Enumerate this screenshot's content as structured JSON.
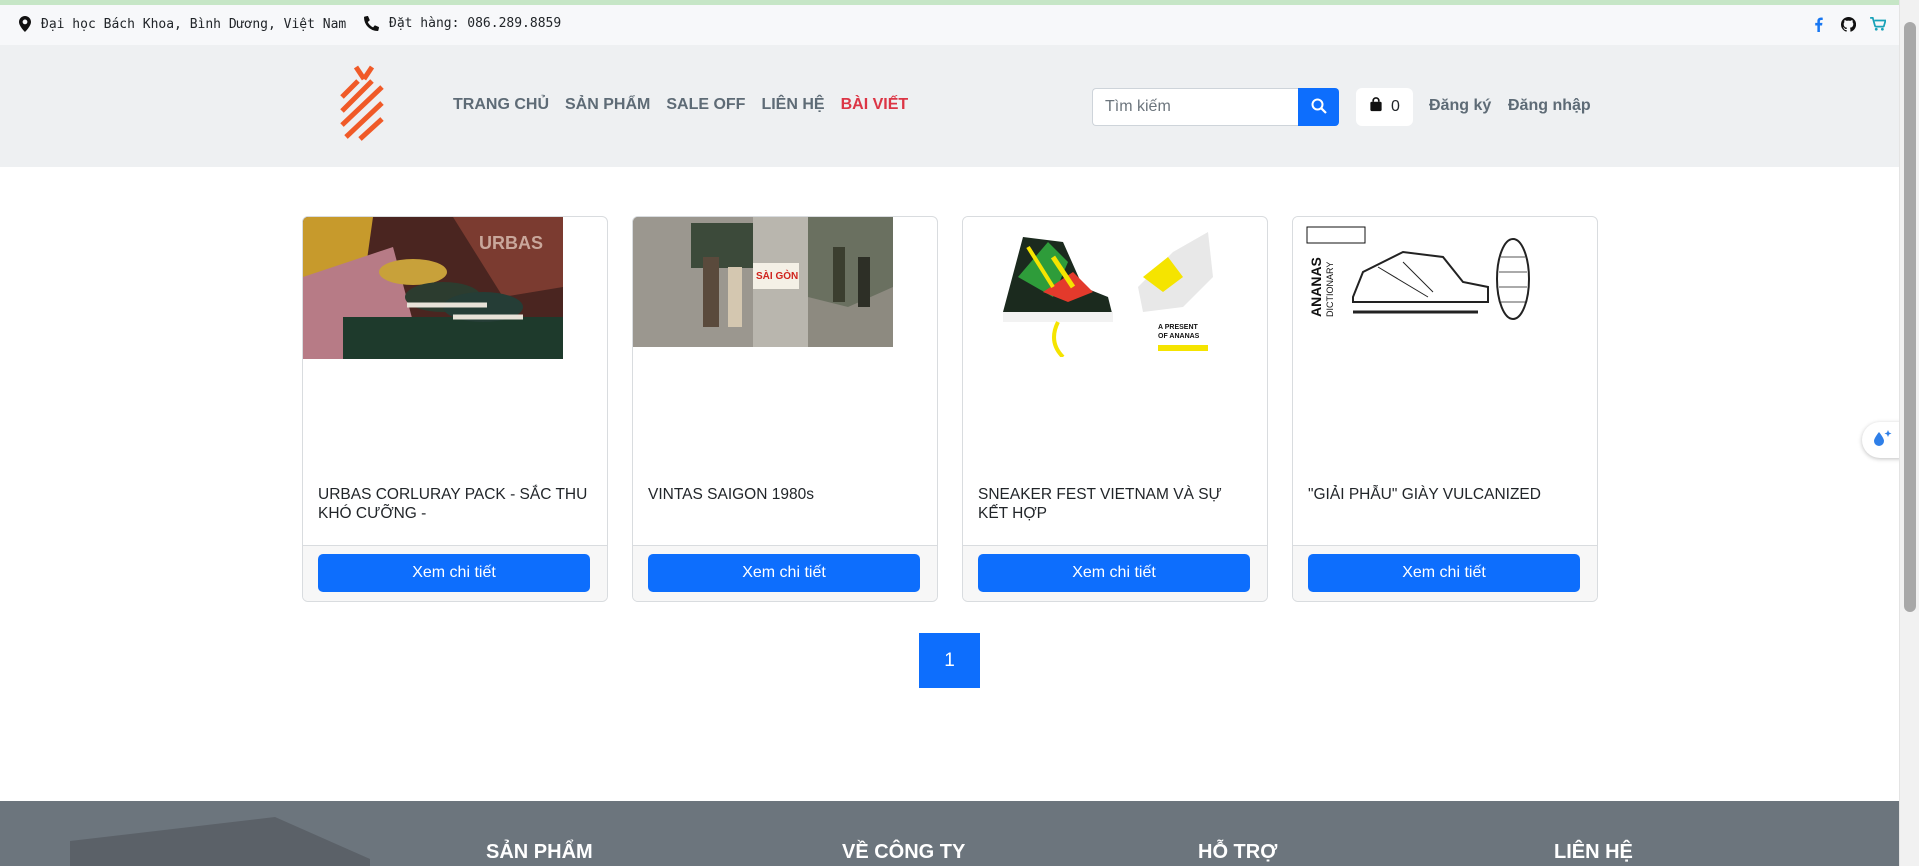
{
  "topbar": {
    "address": "Đại học Bách Khoa, Bình Dương, Việt Nam",
    "phone": "Đặt hàng: 086.289.8859",
    "address_icon": "map-marker-icon",
    "phone_icon": "phone-icon",
    "socials": [
      "facebook-icon",
      "github-icon",
      "cart-icon"
    ]
  },
  "header": {
    "nav": [
      {
        "label": "TRANG CHỦ",
        "active": false
      },
      {
        "label": "SẢN PHẨM",
        "active": false
      },
      {
        "label": "SALE OFF",
        "active": false
      },
      {
        "label": "LIÊN HỆ",
        "active": false
      },
      {
        "label": "BÀI VIẾT",
        "active": true
      }
    ],
    "search": {
      "placeholder": "Tìm kiếm",
      "value": ""
    },
    "cart_count": "0",
    "register": "Đăng ký",
    "login": "Đăng nhập"
  },
  "posts": [
    {
      "title": "URBAS CORLURAY PACK - SẮC THU KHÓ CƯỠNG -",
      "button": "Xem chi tiết"
    },
    {
      "title": "VINTAS SAIGON 1980s",
      "button": "Xem chi tiết"
    },
    {
      "title": "SNEAKER FEST VIETNAM VÀ SỰ KẾT HỢP",
      "button": "Xem chi tiết"
    },
    {
      "title": "\"GIẢI PHẪU\" GIÀY VULCANIZED",
      "button": "Xem chi tiết"
    }
  ],
  "pagination": {
    "current": "1"
  },
  "footer": {
    "columns": [
      "SẢN PHẨM",
      "VỀ CÔNG TY",
      "HỖ TRỢ",
      "LIÊN HỆ"
    ]
  },
  "colors": {
    "primary": "#0d6efd",
    "active_nav": "#dc3545",
    "logo": "#f05a28",
    "footer": "#6c757d"
  }
}
